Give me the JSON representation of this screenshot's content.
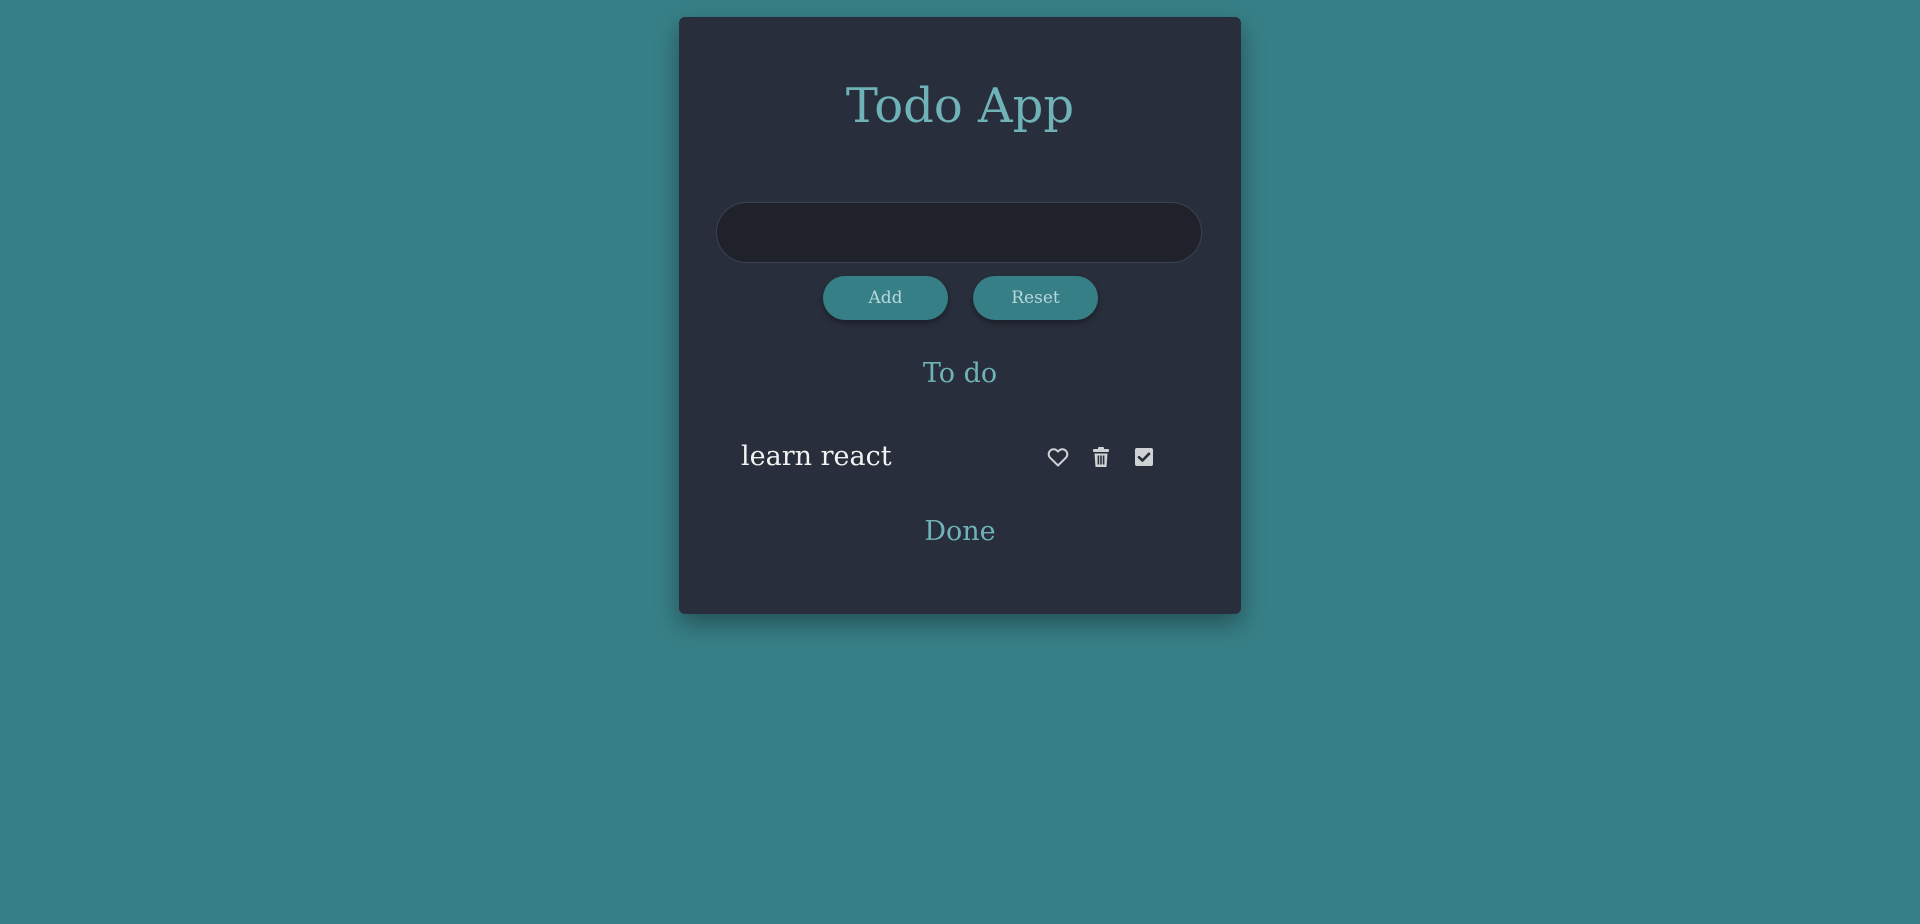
{
  "app": {
    "title": "Todo App"
  },
  "input": {
    "value": "",
    "placeholder": ""
  },
  "buttons": {
    "add_label": "Add",
    "reset_label": "Reset"
  },
  "sections": {
    "todo_title": "To do",
    "done_title": "Done"
  },
  "todos": [
    {
      "text": "learn react",
      "actions": [
        "heart-icon",
        "trash-icon",
        "checkbox-checked-icon"
      ]
    }
  ],
  "done": [],
  "colors": {
    "background": "#377f86",
    "card": "#282e3b",
    "accent": "#6fb3b8",
    "input_bg": "#1f222b",
    "button_bg": "#377f86",
    "icon": "#cfd3d6"
  }
}
